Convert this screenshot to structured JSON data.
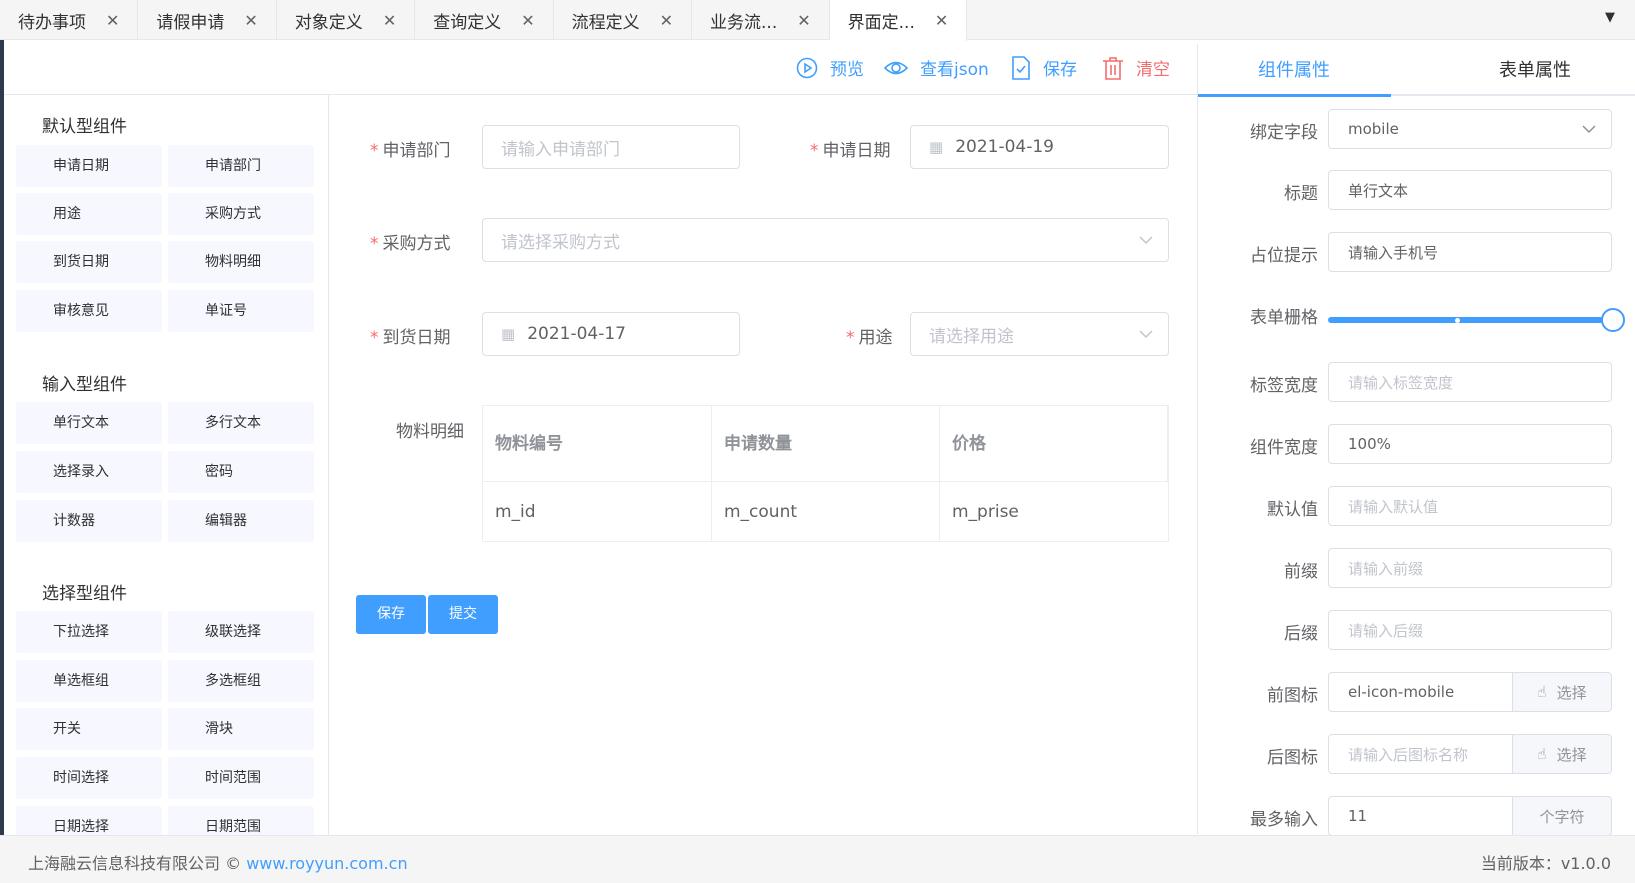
{
  "tabs": [
    {
      "label": "待办事项",
      "close": "✕"
    },
    {
      "label": "请假申请",
      "close": "✕"
    },
    {
      "label": "对象定义",
      "close": "✕"
    },
    {
      "label": "查询定义",
      "close": "✕"
    },
    {
      "label": "流程定义",
      "close": "✕"
    },
    {
      "label": "业务流...",
      "close": "✕"
    },
    {
      "label": "界面定...",
      "close": "✕"
    }
  ],
  "toolbar": {
    "preview": "预览",
    "view_json": "查看json",
    "save": "保存",
    "clear": "清空"
  },
  "groups": {
    "default_title": "默认型组件",
    "default_items": [
      "申请日期",
      "申请部门",
      "用途",
      "采购方式",
      "到货日期",
      "物料明细",
      "审核意见",
      "单证号"
    ],
    "input_title": "输入型组件",
    "input_items": [
      "单行文本",
      "多行文本",
      "选择录入",
      "密码",
      "计数器",
      "编辑器"
    ],
    "select_title": "选择型组件",
    "select_items": [
      "下拉选择",
      "级联选择",
      "单选框组",
      "多选框组",
      "开关",
      "滑块",
      "时间选择",
      "时间范围",
      "日期选择",
      "日期范围"
    ]
  },
  "form": {
    "dept_label": "申请部门",
    "dept_placeholder": "请输入申请部门",
    "date_label": "申请日期",
    "date_value": "2021-04-19",
    "purchase_label": "采购方式",
    "purchase_placeholder": "请选择采购方式",
    "arrival_label": "到货日期",
    "arrival_value": "2021-04-17",
    "usage_label": "用途",
    "usage_placeholder": "请选择用途",
    "material_label": "物料明细",
    "table_headers": [
      "物料编号",
      "申请数量",
      "价格"
    ],
    "table_row": [
      "m_id",
      "m_count",
      "m_prise"
    ],
    "save_btn": "保存",
    "submit_btn": "提交",
    "required_mark": "*"
  },
  "right": {
    "tab_component": "组件属性",
    "tab_form": "表单属性",
    "bind_label": "绑定字段",
    "bind_value": "mobile",
    "title_label": "标题",
    "title_value": "单行文本",
    "placeholder_label": "占位提示",
    "placeholder_value": "请输入手机号",
    "grid_label": "表单栅格",
    "grid_value": 1.0,
    "label_width_label": "标签宽度",
    "label_width_ph": "请输入标签宽度",
    "comp_width_label": "组件宽度",
    "comp_width_value": "100%",
    "default_label": "默认值",
    "default_ph": "请输入默认值",
    "prefix_label": "前缀",
    "prefix_ph": "请输入前缀",
    "suffix_label": "后缀",
    "suffix_ph": "请输入后缀",
    "prefix_icon_label": "前图标",
    "prefix_icon_value": "el-icon-mobile",
    "suffix_icon_label": "后图标",
    "suffix_icon_ph": "请输入后图标名称",
    "choose": "选择",
    "max_label": "最多输入",
    "max_value": "11",
    "max_unit": "个字符"
  },
  "footer": {
    "company": "上海融云信息科技有限公司 ©",
    "site": "www.royyun.com.cn",
    "version": "当前版本：v1.0.0"
  },
  "colors": {
    "primary": "#409eff",
    "danger": "#f56c6c"
  }
}
